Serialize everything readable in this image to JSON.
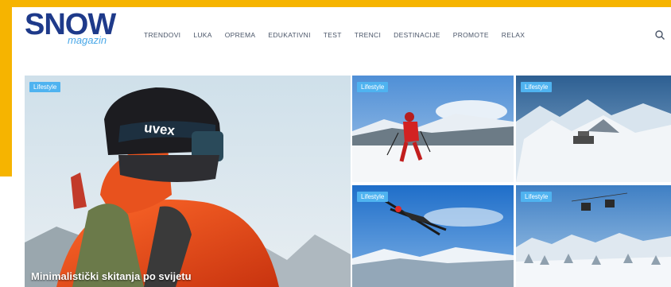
{
  "brand": {
    "name": "SNOW",
    "sub": "magazin",
    "color": "#1e3a8a",
    "accent": "#4aa8e8",
    "frame": "#f6b400"
  },
  "nav": [
    "Trendovi",
    "Luka",
    "Oprema",
    "Edukativni",
    "Test",
    "Trenci",
    "Destinacije",
    "Promote",
    "Relax"
  ],
  "search_icon": "search-icon",
  "articles": [
    {
      "badge": "Lifestyle",
      "title": "Minimalistički skitanja po svijetu"
    },
    {
      "badge": "Lifestyle",
      "title": ""
    },
    {
      "badge": "Lifestyle",
      "title": ""
    },
    {
      "badge": "Lifestyle",
      "title": ""
    },
    {
      "badge": "Lifestyle",
      "title": ""
    }
  ]
}
